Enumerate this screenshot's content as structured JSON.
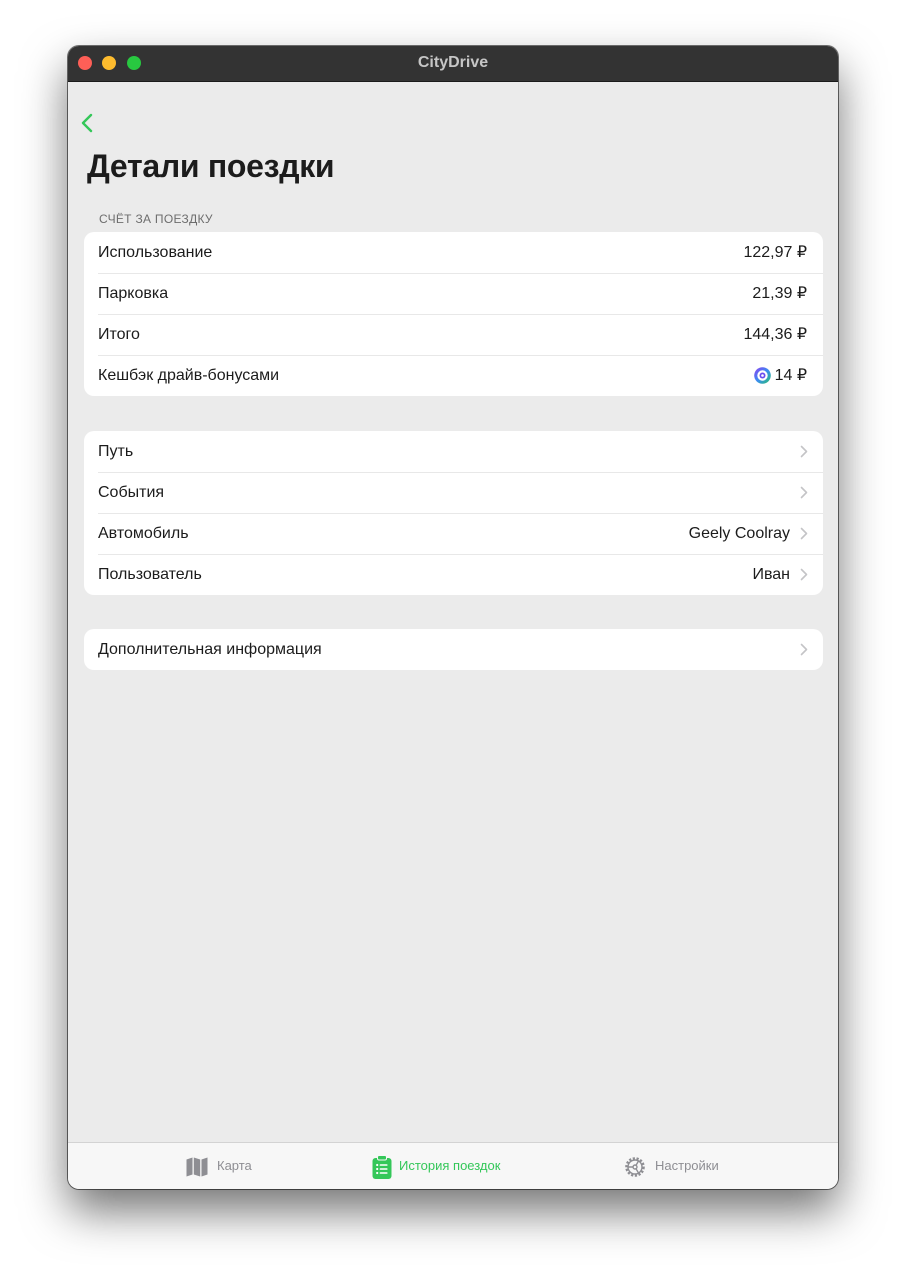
{
  "window": {
    "title": "CityDrive"
  },
  "colors": {
    "accent": "#34c759",
    "tab_inactive": "#8e8e93",
    "traffic_close": "#fe5f57",
    "traffic_minimize": "#febc2e",
    "traffic_maximize": "#28c840"
  },
  "nav": {
    "back_icon": "chevron-left-icon"
  },
  "page": {
    "title": "Детали поездки"
  },
  "bill": {
    "header": "СЧЁТ ЗА ПОЕЗДКУ",
    "rows": [
      {
        "label": "Использование",
        "value": "122,97 ₽"
      },
      {
        "label": "Парковка",
        "value": "21,39 ₽"
      },
      {
        "label": "Итого",
        "value": "144,36 ₽"
      },
      {
        "label": "Кешбэк драйв-бонусами",
        "value": "14 ₽",
        "icon": "drive-bonus-icon"
      }
    ]
  },
  "details": {
    "rows": [
      {
        "label": "Путь",
        "value": ""
      },
      {
        "label": "События",
        "value": ""
      },
      {
        "label": "Автомобиль",
        "value": "Geely Coolray"
      },
      {
        "label": "Пользователь",
        "value": "Иван"
      }
    ]
  },
  "extra": {
    "rows": [
      {
        "label": "Дополнительная информация",
        "value": ""
      }
    ]
  },
  "tabbar": {
    "tabs": [
      {
        "label": "Карта",
        "icon": "map-icon",
        "active": false
      },
      {
        "label": "История поездок",
        "icon": "clipboard-list-icon",
        "active": true
      },
      {
        "label": "Настройки",
        "icon": "gear-steering-icon",
        "active": false
      }
    ]
  }
}
